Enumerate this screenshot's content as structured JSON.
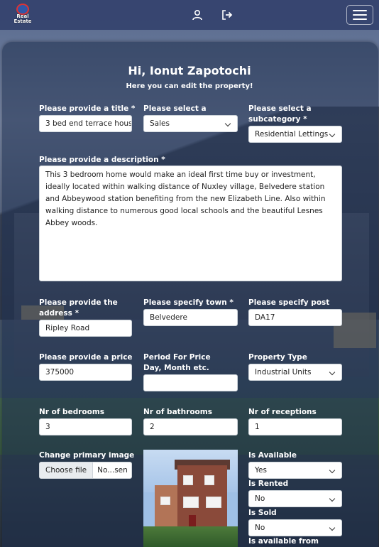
{
  "app": {
    "logo_text": "Real Estate"
  },
  "header": {
    "greeting": "Hi, Ionut Zapotochi",
    "subtitle": "Here you can edit the property!"
  },
  "form": {
    "title_label": "Please provide a title *",
    "title_value": "3 bed end terrace hous",
    "category_label": "Please select a category *",
    "category_value": "Sales",
    "subcategory_label": "Please select a subcategory *",
    "subcategory_value": "Residential Lettings",
    "description_label": "Please provide a description *",
    "description_value": "This 3 bedroom home would make an ideal first time buy or investment, ideally located within walking distance of Nuxley village, Belvedere station and Abbeywood station benefiting from the new Elizabeth Line. Also within walking distance to numerous good local schools and the beautiful Lesnes Abbey woods.",
    "address_label": "Please provide the address *",
    "address_value": "Ripley Road",
    "town_label": "Please specify town *",
    "town_value": "Belvedere",
    "postcode_label": "Please specify post code *",
    "postcode_value": "DA17",
    "price_label": "Please provide a price *",
    "price_value": "375000",
    "period_label": "Period For Price Day, Month etc.",
    "period_value": "",
    "property_type_label": "Property Type",
    "property_type_value": "Industrial Units",
    "bedrooms_label": "Nr of bedrooms",
    "bedrooms_value": "3",
    "bathrooms_label": "Nr of bathrooms",
    "bathrooms_value": "2",
    "receptions_label": "Nr of receptions",
    "receptions_value": "1",
    "image_label": "Change primary image",
    "file_button": "Choose file",
    "file_name": "No...sen",
    "available_label": "Is Available",
    "available_value": "Yes",
    "rented_label": "Is Rented",
    "rented_value": "No",
    "sold_label": "Is Sold",
    "sold_value": "No",
    "available_from_label": "Is available from"
  },
  "icons": {
    "user": "user-icon",
    "logout": "logout-icon",
    "menu": "hamburger-menu-icon"
  }
}
